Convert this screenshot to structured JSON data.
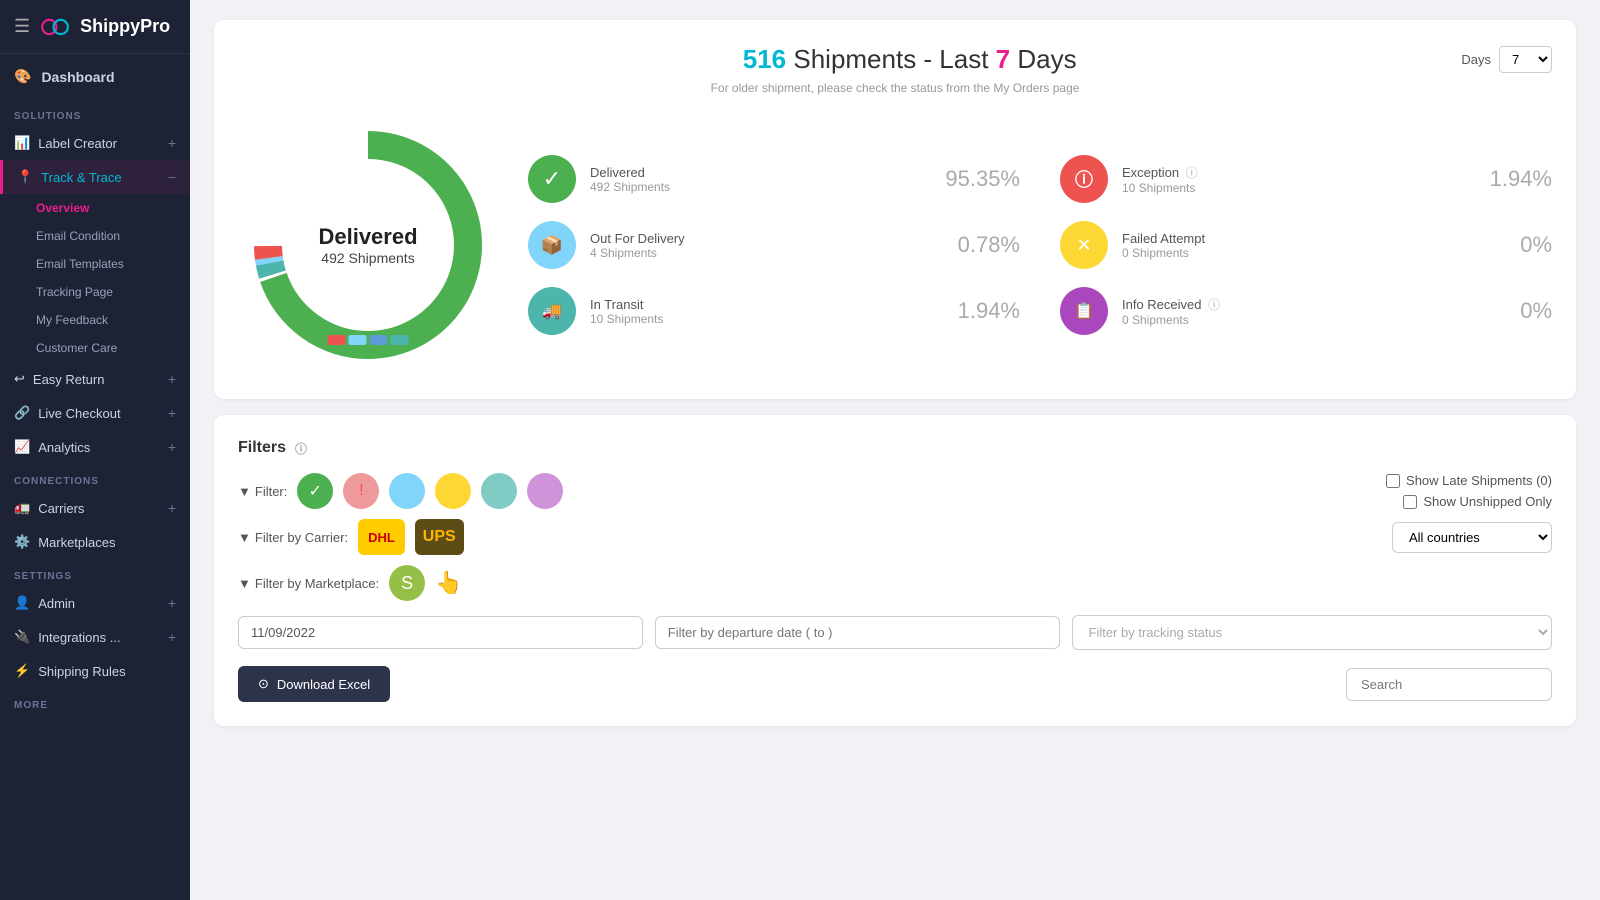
{
  "app": {
    "name": "ShippyPro",
    "hamburger": "☰"
  },
  "sidebar": {
    "dashboard_label": "Dashboard",
    "sections": [
      {
        "label": "SOLUTIONS",
        "items": [
          {
            "id": "label-creator",
            "label": "Label Creator",
            "icon": "📊",
            "expandable": true,
            "expanded": false
          },
          {
            "id": "track-trace",
            "label": "Track & Trace",
            "icon": "📍",
            "expandable": true,
            "expanded": true,
            "active": true,
            "subitems": [
              {
                "id": "overview",
                "label": "Overview",
                "active": true
              },
              {
                "id": "email-condition",
                "label": "Email Condition"
              },
              {
                "id": "email-templates",
                "label": "Email Templates"
              },
              {
                "id": "tracking-page",
                "label": "Tracking Page"
              },
              {
                "id": "my-feedback",
                "label": "My Feedback"
              },
              {
                "id": "customer-care",
                "label": "Customer Care"
              }
            ]
          },
          {
            "id": "easy-return",
            "label": "Easy Return",
            "icon": "↩",
            "expandable": true
          },
          {
            "id": "live-checkout",
            "label": "Live Checkout",
            "icon": "🔗",
            "expandable": true
          },
          {
            "id": "analytics",
            "label": "Analytics",
            "icon": "📈",
            "expandable": true
          }
        ]
      },
      {
        "label": "CONNECTIONS",
        "items": [
          {
            "id": "carriers",
            "label": "Carriers",
            "icon": "🚛",
            "expandable": true
          },
          {
            "id": "marketplaces",
            "label": "Marketplaces",
            "icon": "⚙️"
          }
        ]
      },
      {
        "label": "SETTINGS",
        "items": [
          {
            "id": "admin",
            "label": "Admin",
            "icon": "👤",
            "expandable": true
          },
          {
            "id": "integrations",
            "label": "Integrations ...",
            "icon": "🔌",
            "expandable": true
          },
          {
            "id": "shipping-rules",
            "label": "Shipping Rules",
            "icon": "⚡"
          }
        ]
      },
      {
        "label": "MORE",
        "items": []
      }
    ]
  },
  "main": {
    "header": {
      "count": "516",
      "title": "Shipments - Last",
      "days_num": "7",
      "days_label": "Days",
      "subtitle": "For older shipment, please check the status from the My Orders page",
      "days_select_label": "Days",
      "days_value": "7"
    },
    "donut": {
      "center_label": "Delivered",
      "center_sub": "492 Shipments",
      "segments": [
        {
          "label": "Delivered",
          "color": "#4caf50",
          "value": 95.35
        },
        {
          "label": "Out For Delivery",
          "color": "#81d4fa",
          "value": 0.78
        },
        {
          "label": "In Transit",
          "color": "#4db6ac",
          "value": 1.94
        },
        {
          "label": "Exception",
          "color": "#ef5350",
          "value": 1.94
        }
      ],
      "bars": [
        {
          "color": "#ef5350"
        },
        {
          "color": "#81d4fa"
        },
        {
          "color": "#5c9bd4"
        },
        {
          "color": "#4db6ac"
        }
      ]
    },
    "stats": [
      {
        "id": "delivered",
        "label": "Delivered",
        "count": "492 Shipments",
        "percent": "95.35%",
        "icon_class": "green",
        "icon": "✓"
      },
      {
        "id": "exception",
        "label": "Exception",
        "count": "10 Shipments",
        "percent": "1.94%",
        "icon_class": "red",
        "icon": "ⓘ",
        "has_info": true
      },
      {
        "id": "out-for-delivery",
        "label": "Out For Delivery",
        "count": "4 Shipments",
        "percent": "0.78%",
        "icon_class": "blue-light",
        "icon": "📦"
      },
      {
        "id": "failed-attempt",
        "label": "Failed Attempt",
        "count": "0 Shipments",
        "percent": "0%",
        "icon_class": "yellow",
        "icon": "✕"
      },
      {
        "id": "in-transit",
        "label": "In Transit",
        "count": "10 Shipments",
        "percent": "1.94%",
        "icon_class": "teal",
        "icon": "🚚"
      },
      {
        "id": "info-received",
        "label": "Info Received",
        "count": "0 Shipments",
        "percent": "0%",
        "icon_class": "purple",
        "icon": "📋",
        "has_info": true
      }
    ],
    "filters": {
      "title": "Filters",
      "filter_label": "Filter:",
      "carrier_label": "Filter by Carrier:",
      "marketplace_label": "Filter by Marketplace:",
      "show_late_label": "Show Late Shipments (0)",
      "show_unshipped_label": "Show Unshipped Only",
      "all_countries_label": "All countries",
      "date_from": "11/09/2022",
      "date_from_placeholder": "11/09/2022",
      "date_to_placeholder": "Filter by departure date ( to )",
      "tracking_status_placeholder": "Filter by tracking status",
      "download_label": "Download Excel",
      "search_placeholder": "Search",
      "filter_circles": [
        {
          "id": "fc-green",
          "class": "green",
          "icon": "✓"
        },
        {
          "id": "fc-red",
          "class": "red-light",
          "icon": "!"
        },
        {
          "id": "fc-blue",
          "class": "blue-c",
          "icon": ""
        },
        {
          "id": "fc-yellow",
          "class": "yellow-c",
          "icon": ""
        },
        {
          "id": "fc-teal",
          "class": "teal-c",
          "icon": ""
        },
        {
          "id": "fc-purple",
          "class": "purple-c",
          "icon": ""
        }
      ]
    }
  }
}
